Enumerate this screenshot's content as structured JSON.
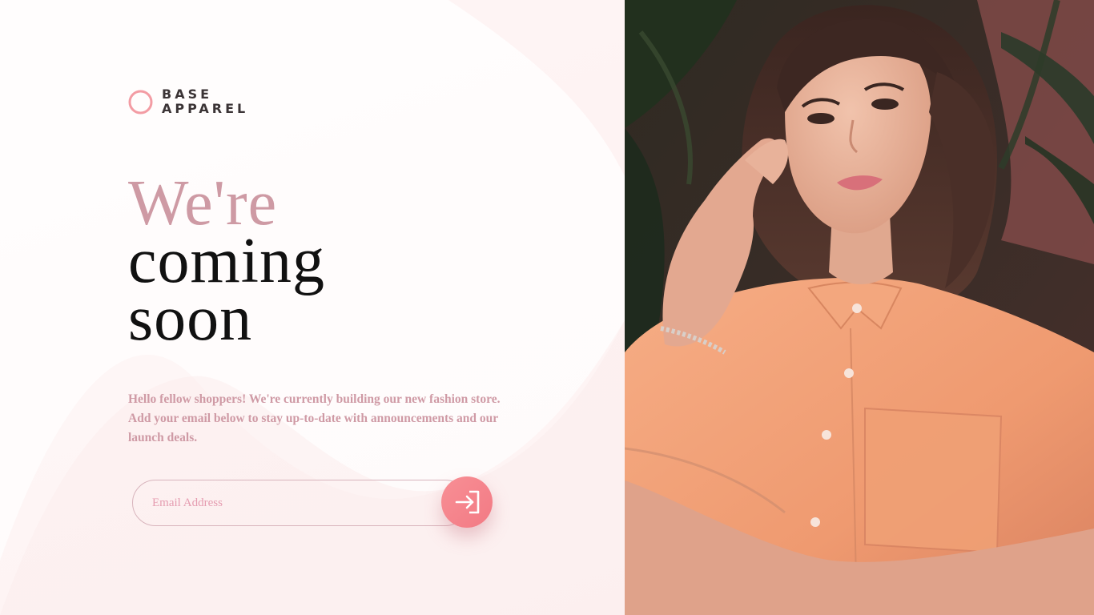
{
  "brand": {
    "line1": "BASE",
    "line2": "APPAREL",
    "accent_color": "#f39ca4",
    "icon": "ring-logo-icon"
  },
  "headline": {
    "line1": "We're",
    "line2": "coming",
    "line3": "soon",
    "accent_color": "#ce9aa4"
  },
  "intro": {
    "text": "Hello fellow shoppers! We're currently building our new fashion store. Add your email below to stay up-to-date with announcements and our launch deals."
  },
  "signup": {
    "email_placeholder": "Email Address",
    "email_value": "",
    "submit_icon": "arrow-right-into-bracket-icon",
    "button_color": "#f6858f"
  },
  "hero": {
    "description_icon": "woman-in-orange-shirt-photo",
    "shirt_color": "#f2a178",
    "background_color": "#3a2a26"
  }
}
